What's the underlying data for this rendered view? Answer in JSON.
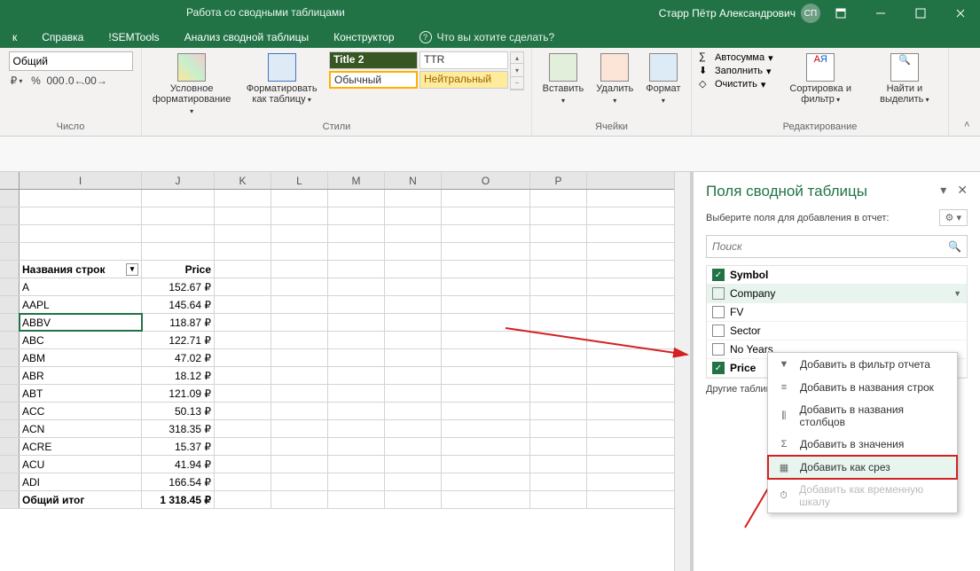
{
  "titlebar": {
    "contextual": "Работа со сводными таблицами",
    "user": "Старр Пётр Александрович",
    "initials": "СП"
  },
  "tabs": {
    "t0": "к",
    "help": "Справка",
    "semtools": "!SEMTools",
    "analyze": "Анализ сводной таблицы",
    "design": "Конструктор",
    "tellme": "Что вы хотите сделать?"
  },
  "ribbon": {
    "number": {
      "format": "Общий",
      "label": "Число"
    },
    "styles": {
      "cond": "Условное форматирование",
      "table": "Форматировать как таблицу",
      "s1": "Title 2",
      "s2": "TTR",
      "s3": "Обычный",
      "s4": "Нейтральный",
      "label": "Стили"
    },
    "cells": {
      "insert": "Вставить",
      "delete": "Удалить",
      "format": "Формат",
      "label": "Ячейки"
    },
    "edit": {
      "sum": "Автосумма",
      "fill": "Заполнить",
      "clear": "Очистить",
      "sort": "Сортировка и фильтр",
      "find": "Найти и выделить",
      "label": "Редактирование"
    }
  },
  "cols": [
    "I",
    "J",
    "K",
    "L",
    "M",
    "N",
    "O",
    "P"
  ],
  "table": {
    "hdr_name": "Названия строк",
    "hdr_price": "Price",
    "rows": [
      {
        "n": "A",
        "p": "152.67 ₽"
      },
      {
        "n": "AAPL",
        "p": "145.64 ₽"
      },
      {
        "n": "ABBV",
        "p": "118.87 ₽"
      },
      {
        "n": "ABC",
        "p": "122.71 ₽"
      },
      {
        "n": "ABM",
        "p": "47.02 ₽"
      },
      {
        "n": "ABR",
        "p": "18.12 ₽"
      },
      {
        "n": "ABT",
        "p": "121.09 ₽"
      },
      {
        "n": "ACC",
        "p": "50.13 ₽"
      },
      {
        "n": "ACN",
        "p": "318.35 ₽"
      },
      {
        "n": "ACRE",
        "p": "15.37 ₽"
      },
      {
        "n": "ACU",
        "p": "41.94 ₽"
      },
      {
        "n": "ADI",
        "p": "166.54 ₽"
      }
    ],
    "total_lbl": "Общий итог",
    "total_val": "1 318.45 ₽"
  },
  "pane": {
    "title": "Поля сводной таблицы",
    "sub": "Выберите поля для добавления в отчет:",
    "search": "Поиск",
    "fields": {
      "symbol": "Symbol",
      "company": "Company",
      "fv": "FV",
      "sector": "Sector",
      "years": "No Years",
      "price": "Price"
    },
    "other": "Другие таблицы..."
  },
  "ctx": {
    "filter": "Добавить в фильтр отчета",
    "rows": "Добавить в названия строк",
    "cols": "Добавить в названия столбцов",
    "vals": "Добавить в значения",
    "slicer": "Добавить как срез",
    "timeline": "Добавить как временную шкалу"
  }
}
